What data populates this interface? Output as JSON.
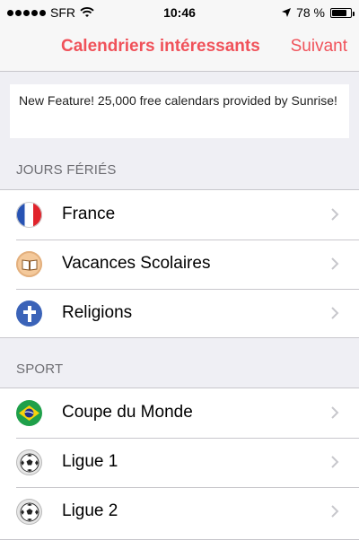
{
  "status_bar": {
    "carrier": "SFR",
    "time": "10:46",
    "battery_text": "78 %",
    "battery_level": 0.78,
    "signal_bars": 5
  },
  "navbar": {
    "title": "Calendriers intéressants",
    "next_label": "Suivant",
    "accent_color": "#f0525a"
  },
  "banner": {
    "text": "New Feature! 25,000 free calendars provided by Sunrise!"
  },
  "sections": [
    {
      "header": "JOURS FÉRIÉS",
      "items": [
        {
          "label": "France",
          "icon": "france-flag-icon"
        },
        {
          "label": "Vacances Scolaires",
          "icon": "book-icon"
        },
        {
          "label": "Religions",
          "icon": "cross-icon"
        }
      ]
    },
    {
      "header": "SPORT",
      "items": [
        {
          "label": "Coupe du Monde",
          "icon": "brazil-flag-icon"
        },
        {
          "label": "Ligue 1",
          "icon": "soccer-ball-icon"
        },
        {
          "label": "Ligue 2",
          "icon": "soccer-ball-icon"
        }
      ]
    }
  ]
}
